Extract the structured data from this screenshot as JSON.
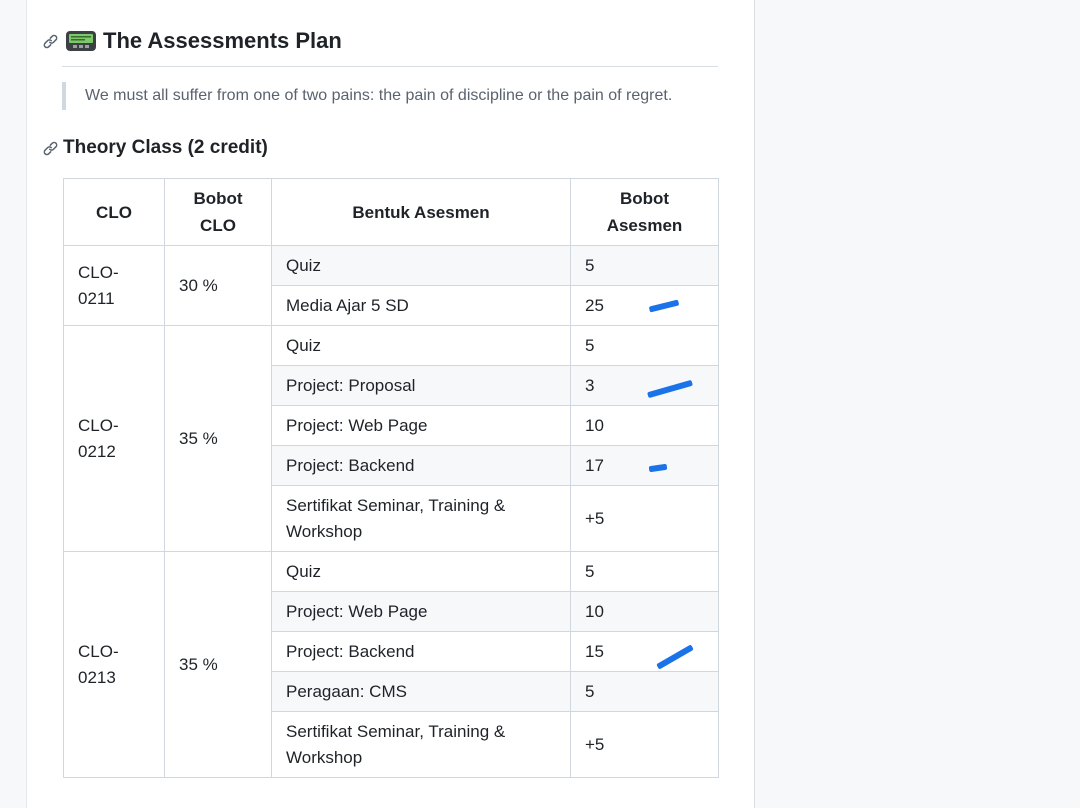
{
  "heading": {
    "title": "The Assessments Plan",
    "icons": [
      "link-icon",
      "pager-icon"
    ]
  },
  "quote": "We must all suffer from one of two pains: the pain of discipline or the pain of regret.",
  "section": {
    "title": "Theory Class (2 credit)",
    "icon": "link-icon"
  },
  "table": {
    "headers": {
      "clo": "CLO",
      "bobot_clo_1": "Bobot",
      "bobot_clo_2": "CLO",
      "bentuk": "Bentuk Asesmen",
      "bobot_as_1": "Bobot",
      "bobot_as_2": "Asesmen"
    },
    "groups": [
      {
        "clo_line1": "CLO-",
        "clo_line2": "0211",
        "bobot": "30 %",
        "rows": [
          {
            "bentuk": "Quiz",
            "nilai": "5"
          },
          {
            "bentuk": "Media Ajar 5 SD",
            "nilai": "25"
          }
        ]
      },
      {
        "clo_line1": "CLO-",
        "clo_line2": "0212",
        "bobot": "35 %",
        "rows": [
          {
            "bentuk": "Quiz",
            "nilai": "5"
          },
          {
            "bentuk": "Project: Proposal",
            "nilai": "3"
          },
          {
            "bentuk": "Project: Web Page",
            "nilai": "10"
          },
          {
            "bentuk": "Project: Backend",
            "nilai": "17"
          },
          {
            "bentuk_line1": "Sertifikat Seminar, Training &",
            "bentuk_line2": "Workshop",
            "nilai": "+5"
          }
        ]
      },
      {
        "clo_line1": "CLO-",
        "clo_line2": "0213",
        "bobot": "35 %",
        "rows": [
          {
            "bentuk": "Quiz",
            "nilai": "5"
          },
          {
            "bentuk": "Project: Web Page",
            "nilai": "10"
          },
          {
            "bentuk": "Project: Backend",
            "nilai": "15"
          },
          {
            "bentuk": "Peragaan: CMS",
            "nilai": "5"
          },
          {
            "bentuk_line1": "Sertifikat Seminar, Training &",
            "bentuk_line2": "Workshop",
            "nilai": "+5"
          }
        ]
      }
    ]
  },
  "colors": {
    "annotation_marks": "#1a73e8",
    "heading_text": "#1f2328",
    "muted_text": "#59636e",
    "border": "#d0d7de",
    "stripe": "#f6f8fa"
  }
}
